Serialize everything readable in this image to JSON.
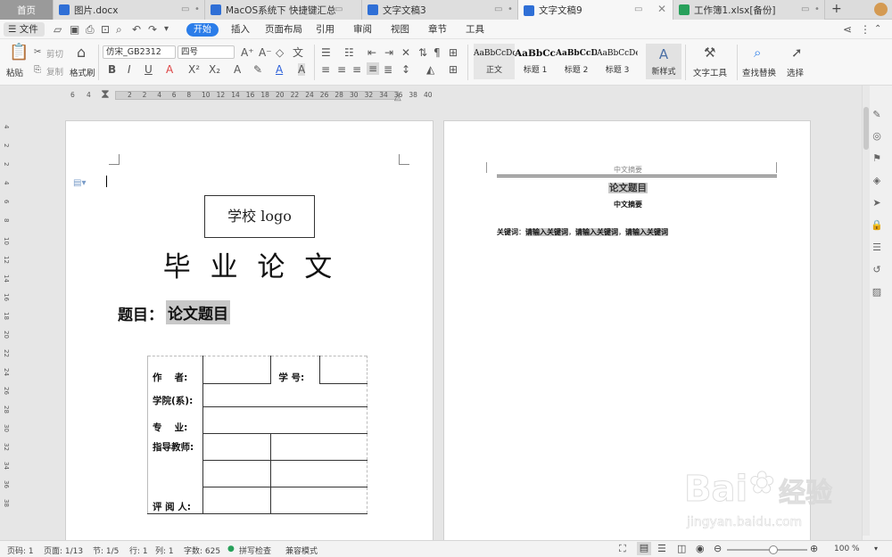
{
  "tabs": {
    "home": "首页",
    "items": [
      {
        "label": "图片.docx",
        "color": "#2f6fd6"
      },
      {
        "label": "MacOS系统下 快捷键汇总",
        "color": "#2f6fd6"
      },
      {
        "label": "文字文稿3",
        "color": "#2f6fd6"
      },
      {
        "label": "文字文稿9",
        "color": "#2f6fd6"
      },
      {
        "label": "工作簿1.xlsx[备份]",
        "color": "#27a05a"
      }
    ],
    "add": "+"
  },
  "menu": {
    "file": "文件",
    "items": [
      "开始",
      "插入",
      "页面布局",
      "引用",
      "审阅",
      "视图",
      "章节",
      "工具"
    ]
  },
  "toolbar": {
    "paste": "粘贴",
    "cut": "剪切",
    "copy": "复制",
    "format_painter": "格式刷",
    "font": "仿宋_GB2312",
    "size": "四号",
    "styles": [
      {
        "preview": "AaBbCcDd",
        "name": "正文"
      },
      {
        "preview": "AaBbCc",
        "name": "标题 1"
      },
      {
        "preview": "AaBbCcDe",
        "name": "标题 2"
      },
      {
        "preview": "AaBbCcDe",
        "name": "标题 3"
      }
    ],
    "new_style": "新样式",
    "text_tools": "文字工具",
    "find_replace": "查找替换",
    "select": "选择"
  },
  "ruler": {
    "ticks": [
      "6",
      "4",
      "2",
      "2",
      "4",
      "6",
      "8",
      "10",
      "12",
      "14",
      "16",
      "18",
      "20",
      "22",
      "24",
      "26",
      "28",
      "30",
      "32",
      "34",
      "36",
      "38",
      "40"
    ],
    "vticks": [
      "4",
      "2",
      "2",
      "4",
      "6",
      "8",
      "10",
      "12",
      "14",
      "16",
      "18",
      "20",
      "22",
      "24",
      "26",
      "28",
      "30",
      "32",
      "34",
      "36",
      "38"
    ]
  },
  "page1": {
    "logo": "学校 logo",
    "title": "毕 业 论 文",
    "topic_label": "题目：",
    "topic_value": "论文题目",
    "form": {
      "author": "作　 者:",
      "student_id": "学 号:",
      "college": "学院(系):",
      "major": "专　 业:",
      "advisor": "指导教师:",
      "reviewer": "评 阅 人:"
    }
  },
  "page2": {
    "header": "中文摘要",
    "title": "论文题目",
    "subtitle": "中文摘要",
    "keywords_label": "关键词",
    "keywords": [
      "请输入关键词",
      "请输入关键词",
      "请输入关键词"
    ]
  },
  "status": {
    "page_code": "页码: 1",
    "pages": "页面: 1/13",
    "section": "节: 1/5",
    "row": "行: 1",
    "col": "列: 1",
    "words": "字数: 625",
    "spell": "拼写检查",
    "compat": "兼容模式",
    "zoom": "100 %"
  },
  "watermark": {
    "brand": "Bai",
    "brand2": "经验",
    "url": "jingyan.baidu.com"
  }
}
